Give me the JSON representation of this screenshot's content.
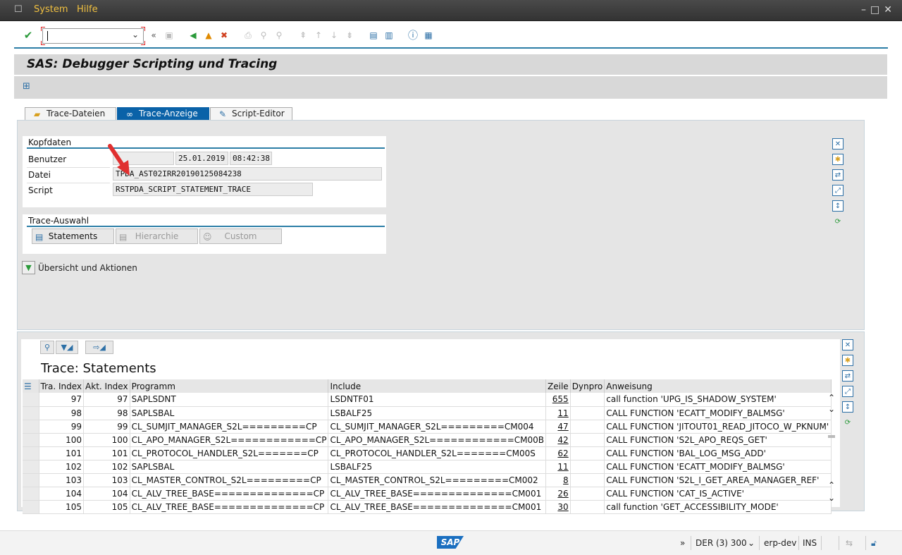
{
  "menu": {
    "items": [
      "System",
      "Hilfe"
    ]
  },
  "page_title": "SAS: Debugger Scripting und Tracing",
  "tabs": [
    {
      "label": "Trace-Dateien",
      "icon": "folder-icon"
    },
    {
      "label": "Trace-Anzeige",
      "icon": "glasses-icon"
    },
    {
      "label": "Script-Editor",
      "icon": "pencil-icon"
    }
  ],
  "kopfdaten": {
    "header": "Kopfdaten",
    "benutzer_label": "Benutzer",
    "benutzer_value": "",
    "date": "25.01.2019",
    "time": "08:42:38",
    "datei_label": "Datei",
    "datei_value": "TPDA_AST02IRR20190125084238",
    "script_label": "Script",
    "script_value": "RSTPDA_SCRIPT_STATEMENT_TRACE"
  },
  "trace_auswahl": {
    "header": "Trace-Auswahl",
    "buttons": [
      "Statements",
      "Hierarchie",
      "Custom"
    ]
  },
  "overview_button": "Übersicht und Aktionen",
  "alv": {
    "title": "Trace: Statements",
    "columns": [
      "Tra. Index",
      "Akt. Index",
      "Programm",
      "Include",
      "Zeile",
      "Dynpro",
      "Anweisung"
    ],
    "rows": [
      {
        "tra": "97",
        "akt": "97",
        "programm": "SAPLSDNT",
        "include": "LSDNTF01",
        "zeile": "655",
        "dynpro": "",
        "anweisung": "call function 'UPG_IS_SHADOW_SYSTEM'"
      },
      {
        "tra": "98",
        "akt": "98",
        "programm": "SAPLSBAL",
        "include": "LSBALF25",
        "zeile": "11",
        "dynpro": "",
        "anweisung": "CALL FUNCTION 'ECATT_MODIFY_BALMSG'"
      },
      {
        "tra": "99",
        "akt": "99",
        "programm": "CL_SUMJIT_MANAGER_S2L=========CP",
        "include": "CL_SUMJIT_MANAGER_S2L=========CM004",
        "zeile": "47",
        "dynpro": "",
        "anweisung": "CALL FUNCTION 'JITOUT01_READ_JITOCO_W_PKNUM'"
      },
      {
        "tra": "100",
        "akt": "100",
        "programm": "CL_APO_MANAGER_S2L============CP",
        "include": "CL_APO_MANAGER_S2L============CM00B",
        "zeile": "42",
        "dynpro": "",
        "anweisung": "CALL FUNCTION 'S2L_APO_REQS_GET'"
      },
      {
        "tra": "101",
        "akt": "101",
        "programm": "CL_PROTOCOL_HANDLER_S2L=======CP",
        "include": "CL_PROTOCOL_HANDLER_S2L=======CM00S",
        "zeile": "62",
        "dynpro": "",
        "anweisung": "CALL FUNCTION 'BAL_LOG_MSG_ADD'"
      },
      {
        "tra": "102",
        "akt": "102",
        "programm": "SAPLSBAL",
        "include": "LSBALF25",
        "zeile": "11",
        "dynpro": "",
        "anweisung": "CALL FUNCTION 'ECATT_MODIFY_BALMSG'"
      },
      {
        "tra": "103",
        "akt": "103",
        "programm": "CL_MASTER_CONTROL_S2L=========CP",
        "include": "CL_MASTER_CONTROL_S2L=========CM002",
        "zeile": "8",
        "dynpro": "",
        "anweisung": "CALL FUNCTION 'S2L_I_GET_AREA_MANAGER_REF'"
      },
      {
        "tra": "104",
        "akt": "104",
        "programm": "CL_ALV_TREE_BASE==============CP",
        "include": "CL_ALV_TREE_BASE==============CM001",
        "zeile": "26",
        "dynpro": "",
        "anweisung": "CALL FUNCTION 'CAT_IS_ACTIVE'"
      },
      {
        "tra": "105",
        "akt": "105",
        "programm": "CL_ALV_TREE_BASE==============CP",
        "include": "CL_ALV_TREE_BASE==============CM001",
        "zeile": "30",
        "dynpro": "",
        "anweisung": "call function 'GET_ACCESSIBILITY_MODE'"
      }
    ]
  },
  "status": {
    "session": "DER (3) 300",
    "server": "erp-dev",
    "mode": "INS",
    "logo": "SAP"
  },
  "colors": {
    "accent": "#2c7ea6",
    "tab_active": "#0a62a8",
    "menu_text": "#f0c040",
    "arrow": "#e03030"
  }
}
